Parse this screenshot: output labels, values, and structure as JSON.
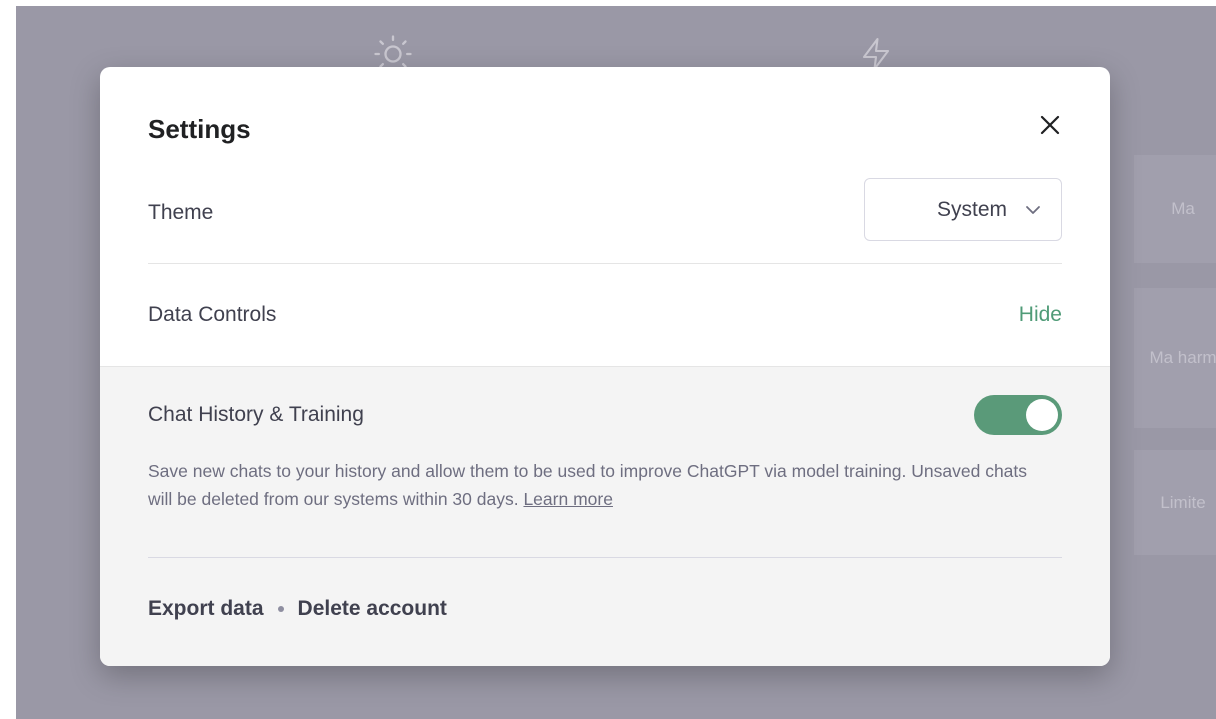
{
  "background": {
    "cards": [
      "Ma",
      "Ma harm",
      "Limite"
    ]
  },
  "modal": {
    "title": "Settings",
    "theme": {
      "label": "Theme",
      "selected": "System"
    },
    "data_controls": {
      "label": "Data Controls",
      "toggle_link": "Hide"
    },
    "chat_history": {
      "label": "Chat History & Training",
      "enabled": true,
      "description": "Save new chats to your history and allow them to be used to improve ChatGPT via model training. Unsaved chats will be deleted from our systems within 30 days.",
      "learn_more": "Learn more"
    },
    "actions": {
      "export": "Export data",
      "delete": "Delete account"
    }
  },
  "colors": {
    "accent": "#5a9a79",
    "link_green": "#4f9b77",
    "backdrop": "#9a98a6"
  }
}
